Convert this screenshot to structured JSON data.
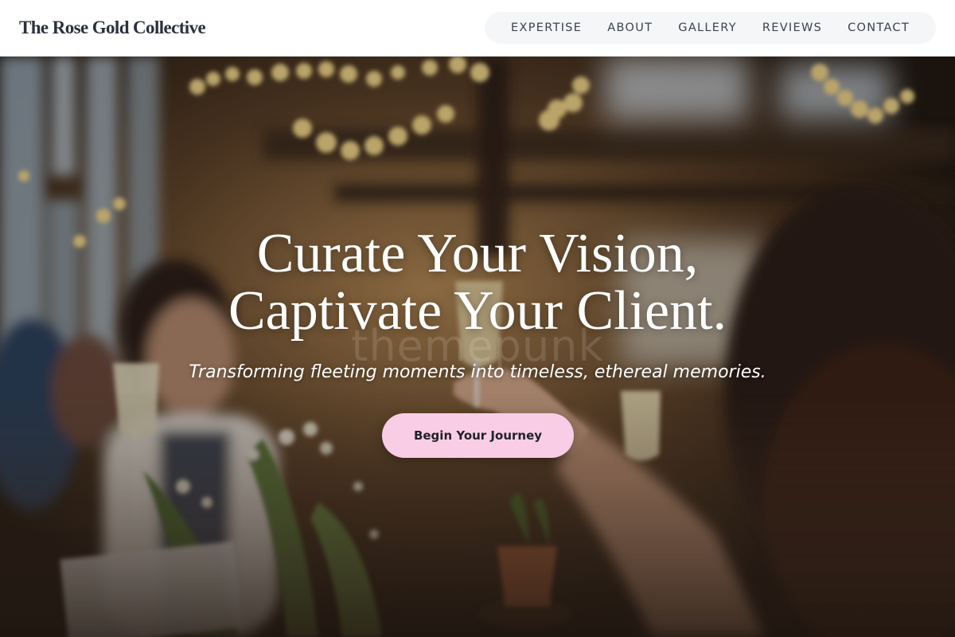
{
  "header": {
    "brand": "The Rose Gold Collective",
    "nav": [
      {
        "label": "EXPERTISE"
      },
      {
        "label": "ABOUT"
      },
      {
        "label": "GALLERY"
      },
      {
        "label": "REVIEWS"
      },
      {
        "label": "CONTACT"
      }
    ]
  },
  "hero": {
    "title_line1": "Curate Your Vision,",
    "title_line2": "Captivate Your Client.",
    "watermark": "themepunk",
    "subtitle": "Transforming fleeting moments into timeless, ethereal memories.",
    "cta_label": "Begin Your Journey",
    "background_image": "wedding-reception-toast-photo"
  },
  "colors": {
    "header_bg": "#ffffff",
    "brand_text": "#2c313c",
    "nav_pill_bg": "#f5f6f7",
    "nav_text": "#3c424e",
    "cta_bg": "#f9cde6",
    "cta_text": "#20232a",
    "hero_text": "#ffffff"
  }
}
